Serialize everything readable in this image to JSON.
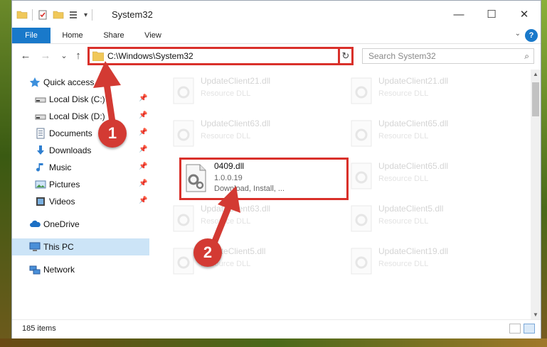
{
  "window": {
    "title": "System32",
    "minimize": "—",
    "maximize": "☐",
    "close": "✕"
  },
  "ribbon": {
    "tabs": [
      {
        "label": "File"
      },
      {
        "label": "Home"
      },
      {
        "label": "Share"
      },
      {
        "label": "View"
      }
    ],
    "help": "?"
  },
  "navigation": {
    "back": "←",
    "forward": "→",
    "recent": "⌄",
    "up": "↑",
    "address": "C:\\Windows\\System32",
    "refresh": "↻",
    "search_placeholder": "Search System32"
  },
  "sidebar": {
    "items": [
      {
        "label": "Quick access",
        "icon": "star-icon",
        "pinned": false
      },
      {
        "label": "Local Disk (C:)",
        "icon": "drive-icon",
        "pinned": true
      },
      {
        "label": "Local Disk (D:)",
        "icon": "drive-icon",
        "pinned": true
      },
      {
        "label": "Documents",
        "icon": "documents-icon",
        "pinned": true
      },
      {
        "label": "Downloads",
        "icon": "download-icon",
        "pinned": true
      },
      {
        "label": "Music",
        "icon": "music-icon",
        "pinned": true
      },
      {
        "label": "Pictures",
        "icon": "pictures-icon",
        "pinned": true
      },
      {
        "label": "Videos",
        "icon": "videos-icon",
        "pinned": true
      },
      {
        "label": "OneDrive",
        "icon": "cloud-icon",
        "pinned": false
      },
      {
        "label": "This PC",
        "icon": "computer-icon",
        "pinned": false,
        "selected": true
      },
      {
        "label": "Network",
        "icon": "network-icon",
        "pinned": false
      }
    ]
  },
  "files": [
    {
      "name": "UpdateClient21.dll",
      "sub": "Resource DLL",
      "faded": true
    },
    {
      "name": "UpdateClient21.dll",
      "sub": "Resource DLL",
      "faded": true
    },
    {
      "name": "UpdateClient63.dll",
      "sub": "Resource DLL",
      "faded": true
    },
    {
      "name": "UpdateClient65.dll",
      "sub": "Resource DLL",
      "faded": true
    },
    {
      "name": "0409.dll",
      "sub": "1.0.0.19",
      "sub2": "Download, Install, ...",
      "faded": false,
      "highlight": true
    },
    {
      "name": "UpdateClient65.dll",
      "sub": "Resource DLL",
      "faded": true
    },
    {
      "name": "UpdateClient63.dll",
      "sub": "Resource DLL",
      "faded": true
    },
    {
      "name": "UpdateClient5.dll",
      "sub": "Resource DLL",
      "faded": true
    },
    {
      "name": "UpdateClient5.dll",
      "sub": "Resource DLL",
      "faded": true
    },
    {
      "name": "UpdateClient19.dll",
      "sub": "Resource DLL",
      "faded": true
    }
  ],
  "status": {
    "item_count": "185 items"
  },
  "annotations": {
    "step1": "1",
    "step2": "2",
    "color": "#d33a33"
  }
}
